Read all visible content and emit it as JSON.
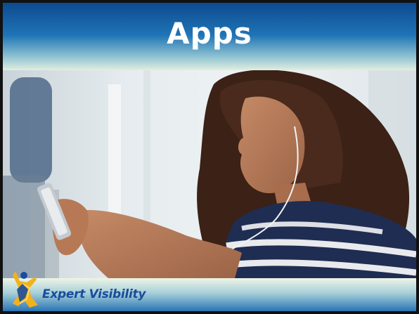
{
  "slide": {
    "title": "Apps",
    "brand": {
      "name": "Expert Visibility",
      "logo_icon": "person-star-icon"
    },
    "photo": {
      "icon": "woman-with-smartphone-photo"
    }
  },
  "colors": {
    "title_dark": "#0d4a8f",
    "title_light": "#e2eee0",
    "brand_blue": "#1a4c9c",
    "logo_gold": "#f2b21c"
  }
}
